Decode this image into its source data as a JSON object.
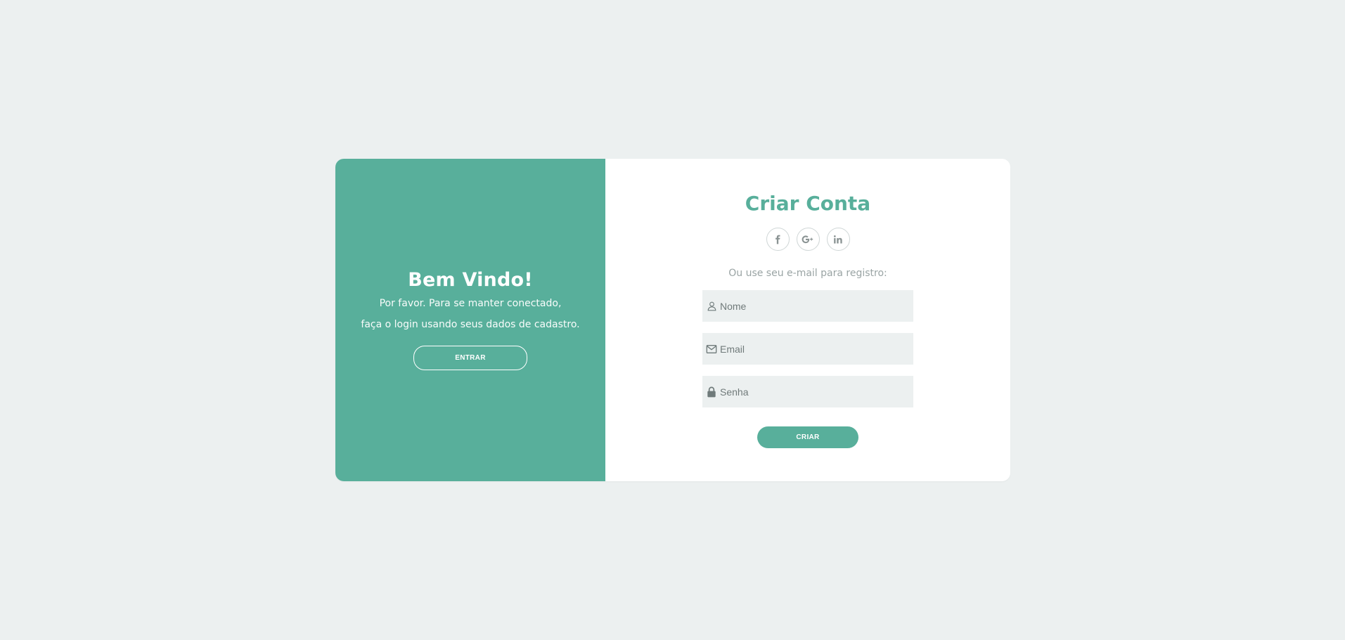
{
  "left_panel": {
    "title": "Bem Vindo!",
    "text_line1": "Por favor. Para se manter conectado,",
    "text_line2": "faça o login usando seus dados de cadastro.",
    "button_label": "ENTRAR"
  },
  "right_panel": {
    "title": "Criar Conta",
    "social": [
      {
        "name": "facebook-icon",
        "glyph": "f"
      },
      {
        "name": "google-plus-icon",
        "glyph": "G+"
      },
      {
        "name": "linkedin-icon",
        "glyph": "in"
      }
    ],
    "hint": "Ou use seu e-mail para registro:",
    "fields": {
      "name_placeholder": "Nome",
      "email_placeholder": "Email",
      "password_placeholder": "Senha"
    },
    "submit_label": "CRIAR"
  },
  "colors": {
    "accent": "#58af9b",
    "background": "#ecf0f0",
    "field_bg": "#ecf0f0"
  }
}
